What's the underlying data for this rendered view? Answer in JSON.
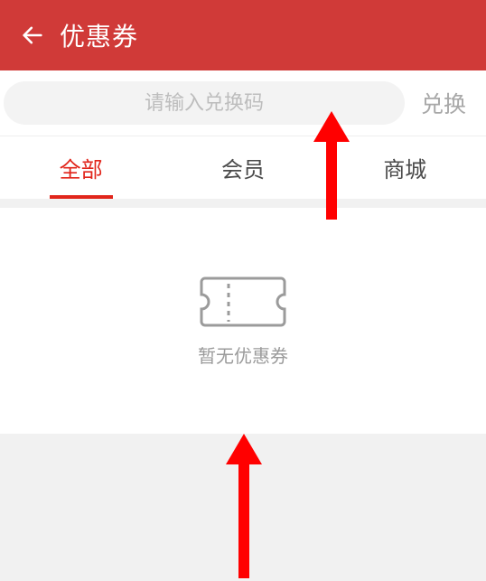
{
  "header": {
    "title": "优惠券"
  },
  "exchange": {
    "placeholder": "请输入兑换码",
    "button_label": "兑换"
  },
  "tabs": [
    {
      "label": "全部",
      "active": true
    },
    {
      "label": "会员",
      "active": false
    },
    {
      "label": "商城",
      "active": false
    }
  ],
  "empty": {
    "message": "暂无优惠券"
  },
  "colors": {
    "primary": "#d03a38",
    "accent": "#e1251b"
  }
}
